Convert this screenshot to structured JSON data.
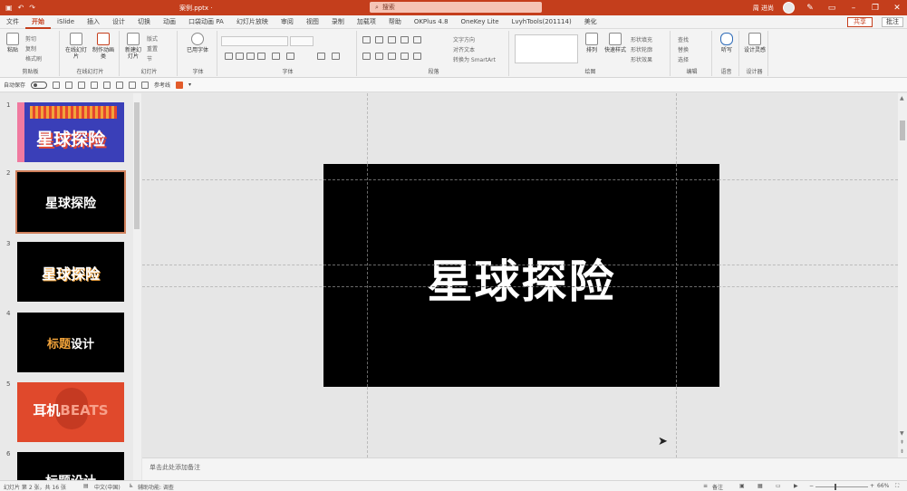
{
  "app": {
    "doc_title": "案例.pptx ·",
    "search_placeholder": "搜索",
    "user_name": "周 进尚"
  },
  "tabs": [
    "文件",
    "开始",
    "iSlide",
    "插入",
    "设计",
    "切换",
    "动画",
    "口袋动画 PA",
    "幻灯片放映",
    "审阅",
    "视图",
    "录制",
    "加载项",
    "帮助",
    "OKPlus 4.8",
    "OneKey Lite",
    "LvyhTools(201114)",
    "美化"
  ],
  "tabbar": {
    "share": "共享",
    "comment": "批注"
  },
  "ribbon": {
    "groups": {
      "clipboard": "剪贴板",
      "online": "在线幻灯片",
      "slides": "幻灯片",
      "font_group": "字体",
      "font": "字体",
      "paragraph": "段落",
      "drawing": "绘图",
      "editing": "编辑",
      "voice": "语音",
      "designer": "设计器"
    },
    "paste": "粘贴",
    "cut": "剪切",
    "copy": "复制",
    "format_painter": "格式刷",
    "online_slides": "在线幻灯片",
    "add_animation": "制作动画类",
    "new_slide": "新建幻灯片",
    "layout": "版式",
    "reset": "重置",
    "section": "节",
    "used_fonts": "已用字体",
    "text_direction": "文字方向",
    "align_text": "对齐文本",
    "smartart": "转换为 SmartArt",
    "arrange": "排列",
    "quick_styles": "快速样式",
    "shape_fill": "形状填充",
    "shape_outline": "形状轮廓",
    "shape_effects": "形状效果",
    "find": "查找",
    "replace": "替换",
    "select": "选择",
    "dictate": "听写",
    "design_ideas": "设计灵感"
  },
  "qat": {
    "autosave": "自动保存",
    "reference_line": "参考线"
  },
  "thumbnails": [
    {
      "num": "1",
      "title": "星球探险"
    },
    {
      "num": "2",
      "title": "星球探险"
    },
    {
      "num": "3",
      "title": "星球探险"
    },
    {
      "num": "4",
      "title_a": "标题",
      "title_b": "设计"
    },
    {
      "num": "5",
      "title_a": "耳机",
      "title_b": "BEATS"
    },
    {
      "num": "6",
      "title": "标题设计"
    }
  ],
  "slide": {
    "title": "星球探险"
  },
  "notes": {
    "placeholder": "单击此处添加备注"
  },
  "status": {
    "slide_count": "幻灯片 第 2 张，共 16 张",
    "language": "中文(中国)",
    "accessibility": "辅助功能: 调查",
    "notes": "备注",
    "zoom": "66%"
  }
}
